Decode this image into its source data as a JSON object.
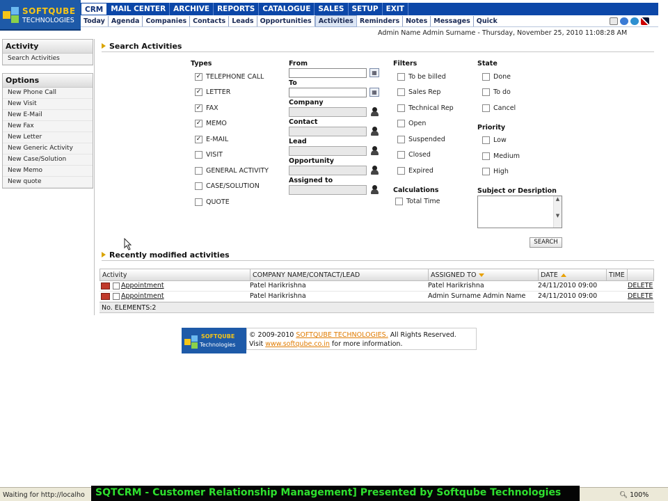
{
  "brand": {
    "name": "SOFTQUBE",
    "subtitle": "TECHNOLOGIES"
  },
  "main_menu": [
    "CRM",
    "MAIL CENTER",
    "ARCHIVE",
    "REPORTS",
    "CATALOGUE",
    "SALES",
    "SETUP",
    "EXIT"
  ],
  "main_menu_active": "CRM",
  "sub_menu": [
    "Today",
    "Agenda",
    "Companies",
    "Contacts",
    "Leads",
    "Opportunities",
    "Activities",
    "Reminders",
    "Notes",
    "Messages",
    "Quick"
  ],
  "sub_menu_active": "Activities",
  "top_icons": [
    "mail-icon",
    "help-icon",
    "globe-icon",
    "uk-flag-icon"
  ],
  "user_line": "Admin Name Admin Surname - Thursday, November 25, 2010 11:08:28 AM",
  "sidebar": {
    "activity": {
      "title": "Activity",
      "items": [
        "Search Activities"
      ]
    },
    "options": {
      "title": "Options",
      "items": [
        "New Phone Call",
        "New Visit",
        "New E-Mail",
        "New Fax",
        "New Letter",
        "New Generic Activity",
        "New Case/Solution",
        "New Memo",
        "New quote"
      ]
    }
  },
  "search": {
    "title": "Search Activities",
    "types_label": "Types",
    "types": [
      {
        "label": "TELEPHONE CALL",
        "checked": true
      },
      {
        "label": "LETTER",
        "checked": true
      },
      {
        "label": "FAX",
        "checked": true
      },
      {
        "label": "MEMO",
        "checked": true
      },
      {
        "label": "E-MAIL",
        "checked": true
      },
      {
        "label": "VISIT",
        "checked": false
      },
      {
        "label": "GENERAL ACTIVITY",
        "checked": false
      },
      {
        "label": "CASE/SOLUTION",
        "checked": false
      },
      {
        "label": "QUOTE",
        "checked": false
      }
    ],
    "from_label": "From",
    "to_label": "To",
    "company_label": "Company",
    "contact_label": "Contact",
    "lead_label": "Lead",
    "opportunity_label": "Opportunity",
    "assigned_label": "Assigned to",
    "from_value": "",
    "to_value": "",
    "filters_label": "Filters",
    "filters": [
      {
        "label": "To be billed",
        "checked": false
      },
      {
        "label": "Sales Rep",
        "checked": false
      },
      {
        "label": "Technical Rep",
        "checked": false
      },
      {
        "label": "Open",
        "checked": false
      },
      {
        "label": "Suspended",
        "checked": false
      },
      {
        "label": "Closed",
        "checked": false
      },
      {
        "label": "Expired",
        "checked": false
      }
    ],
    "calculations_label": "Calculations",
    "total_time_label": "Total Time",
    "state_label": "State",
    "states": [
      {
        "label": "Done",
        "checked": false
      },
      {
        "label": "To do",
        "checked": false
      },
      {
        "label": "Cancel",
        "checked": false
      }
    ],
    "priority_label": "Priority",
    "priorities": [
      {
        "label": "Low",
        "checked": false
      },
      {
        "label": "Medium",
        "checked": false
      },
      {
        "label": "High",
        "checked": false
      }
    ],
    "subject_label": "Subject or Desription",
    "subject_value": "",
    "search_button": "SEARCH"
  },
  "recent": {
    "title": "Recently modified activities",
    "columns": [
      "Activity",
      "COMPANY NAME/CONTACT/LEAD",
      "ASSIGNED TO",
      "DATE",
      "TIME"
    ],
    "rows": [
      {
        "activity": "Appointment",
        "company": "Patel Harikrishna",
        "assigned": "Patel Harikrishna",
        "date": "24/11/2010 09:00",
        "action": "DELETE"
      },
      {
        "activity": "Appointment",
        "company": "Patel Harikrishna",
        "assigned": "Admin Surname Admin Name",
        "date": "24/11/2010 09:00",
        "action": "DELETE"
      }
    ],
    "footer": "No. ELEMENTS:2"
  },
  "footer": {
    "logo_name": "SOFTQUBE",
    "logo_sub": "Technologies",
    "copyright_pre": "© 2009-2010 ",
    "company_link": "SOFTQUBE TECHNOLOGIES.",
    "copyright_post": " All Rights Reserved.",
    "visit_pre": "Visit ",
    "site_link": "www.softqube.co.in",
    "visit_post": " for more information."
  },
  "statusbar": {
    "status": "Waiting for http://localho",
    "zoom": "100%",
    "banner": "SQTCRM - Customer Relationship Management] Presented by Softqube Technologies"
  },
  "colors": {
    "menu_blue": "#0c47a8",
    "accent_orange": "#e07b00",
    "banner_green": "#2ee02e"
  }
}
